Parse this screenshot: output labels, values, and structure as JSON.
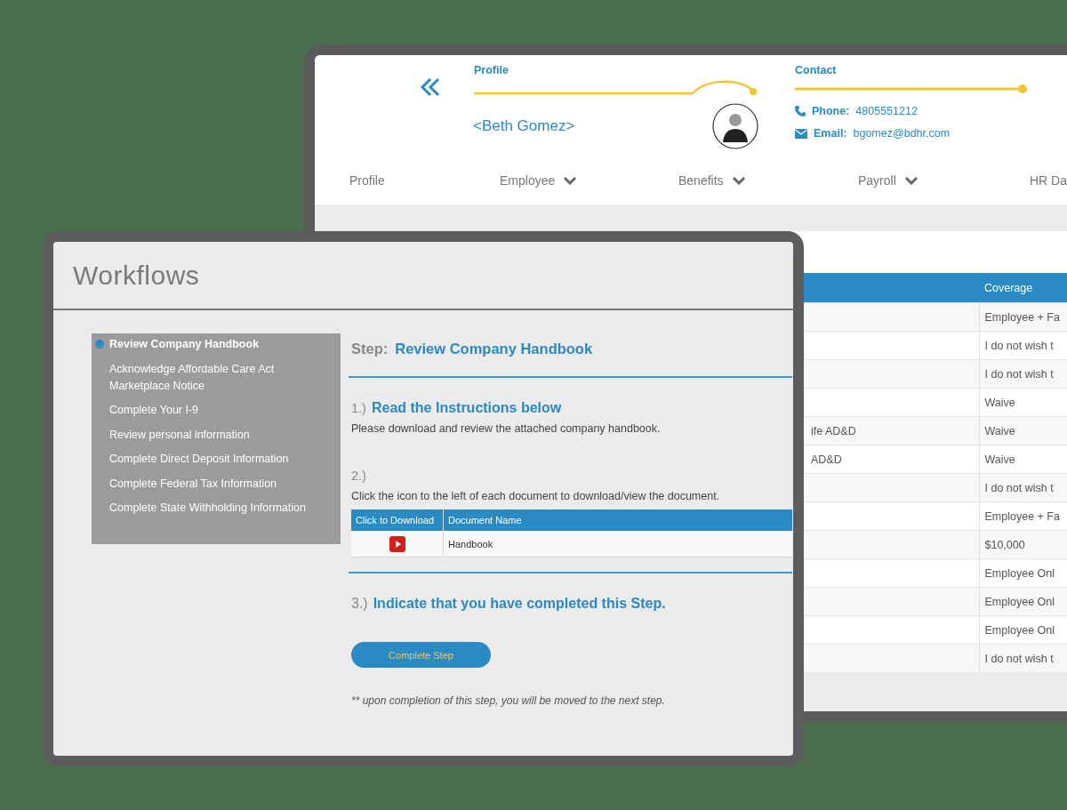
{
  "back_window": {
    "header": {
      "profile_label": "Profile",
      "name": "<Beth Gomez>",
      "contact_label": "Contact",
      "phone_label": "Phone:",
      "phone": "4805551212",
      "email_label": "Email:",
      "email": "bgomez@bdhr.com"
    },
    "nav": [
      {
        "label": "Profile",
        "dropdown": false
      },
      {
        "label": "Employee",
        "dropdown": true
      },
      {
        "label": "Benefits",
        "dropdown": true
      },
      {
        "label": "Payroll",
        "dropdown": true
      },
      {
        "label": "HR Da",
        "dropdown": false
      }
    ],
    "table": {
      "columns": [
        "Coverage"
      ],
      "rows": [
        {
          "coverage": "Employee + Fa"
        },
        {
          "coverage": "I do not wish t"
        },
        {
          "coverage": "I do not wish t"
        },
        {
          "coverage": "Waive"
        },
        {
          "column_1": "ife AD&D",
          "coverage": "Waive"
        },
        {
          "column_1": "AD&D",
          "coverage": "Waive"
        },
        {
          "coverage": "I do not wish t"
        },
        {
          "coverage": "Employee + Fa"
        },
        {
          "coverage": "$10,000"
        },
        {
          "coverage": "Employee Onl"
        },
        {
          "coverage": "Employee Onl"
        },
        {
          "coverage": "Employee Onl"
        },
        {
          "coverage": "I do not wish t"
        }
      ]
    }
  },
  "workflow": {
    "title": "Workflows",
    "steps": [
      {
        "label": "Review Company Handbook",
        "selected": true
      },
      {
        "label": "Acknowledge Affordable Care Act Marketplace Notice",
        "selected": false
      },
      {
        "label": "Complete Your I-9",
        "selected": false
      },
      {
        "label": "Review personal information",
        "selected": false
      },
      {
        "label": "Complete Direct Deposit Information",
        "selected": false
      },
      {
        "label": "Complete Federal Tax Information",
        "selected": false
      },
      {
        "label": "Complete State Withholding Information",
        "selected": false
      }
    ],
    "step_label": "Step:",
    "step_title": "Review Company Handbook",
    "section_1": {
      "number": "1.)",
      "heading": "Read the Instructions below",
      "text": "Please download and review the attached company handbook."
    },
    "section_2": {
      "number": "2.)",
      "text": "Click the icon to the left of each document to download/view the document.",
      "documents": {
        "columns": [
          "Click to Download",
          "Document Name"
        ],
        "rows": [
          {
            "document_name": "Handbook"
          }
        ]
      }
    },
    "section_3": {
      "number": "3.)",
      "heading": "Indicate that you have completed this Step."
    },
    "button": "Complete Step",
    "note": "** upon completion of this step, you will be moved to the next step."
  }
}
